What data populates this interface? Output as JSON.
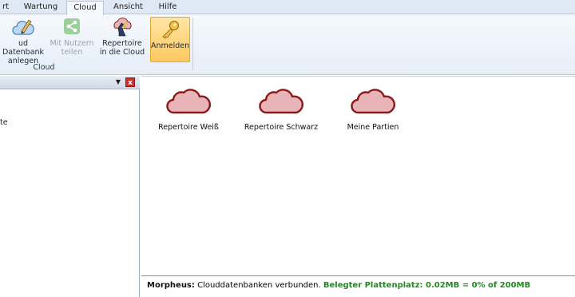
{
  "ribbon_tabs": [
    {
      "label": "rt"
    },
    {
      "label": "Wartung"
    },
    {
      "label": "Cloud"
    },
    {
      "label": "Ansicht"
    },
    {
      "label": "Hilfe"
    }
  ],
  "ribbon": {
    "buttons": [
      {
        "line1": "ud Datenbank",
        "line2": "anlegen",
        "icon": "cloud-pencil-icon",
        "state": "normal"
      },
      {
        "line1": "Mit Nutzern",
        "line2": "teilen",
        "icon": "share-icon",
        "state": "disabled"
      },
      {
        "line1": "Repertoire",
        "line2": "in die Cloud",
        "icon": "chess-knight-icon",
        "state": "normal"
      },
      {
        "line1": "Anmelden",
        "line2": "",
        "icon": "key-icon",
        "state": "highlighted"
      }
    ],
    "group_label": "Cloud"
  },
  "left_panel": {
    "dropdown_glyph": "▼",
    "close_glyph": "x",
    "tree_item": "te"
  },
  "databases": [
    {
      "label": "Repertoire Weiß"
    },
    {
      "label": "Repertoire Schwarz"
    },
    {
      "label": "Meine Partien"
    }
  ],
  "status": {
    "prefix": "Morpheus:",
    "message": "Clouddatenbanken verbunden.",
    "disk_usage": "Belegter Plattenplatz: 0.02MB = 0% of 200MB"
  },
  "colors": {
    "cloud_fill": "#e8b4b8",
    "cloud_stroke": "#8b1a1a",
    "status_green": "#1f8a1f",
    "highlight": "#ffc85e"
  }
}
